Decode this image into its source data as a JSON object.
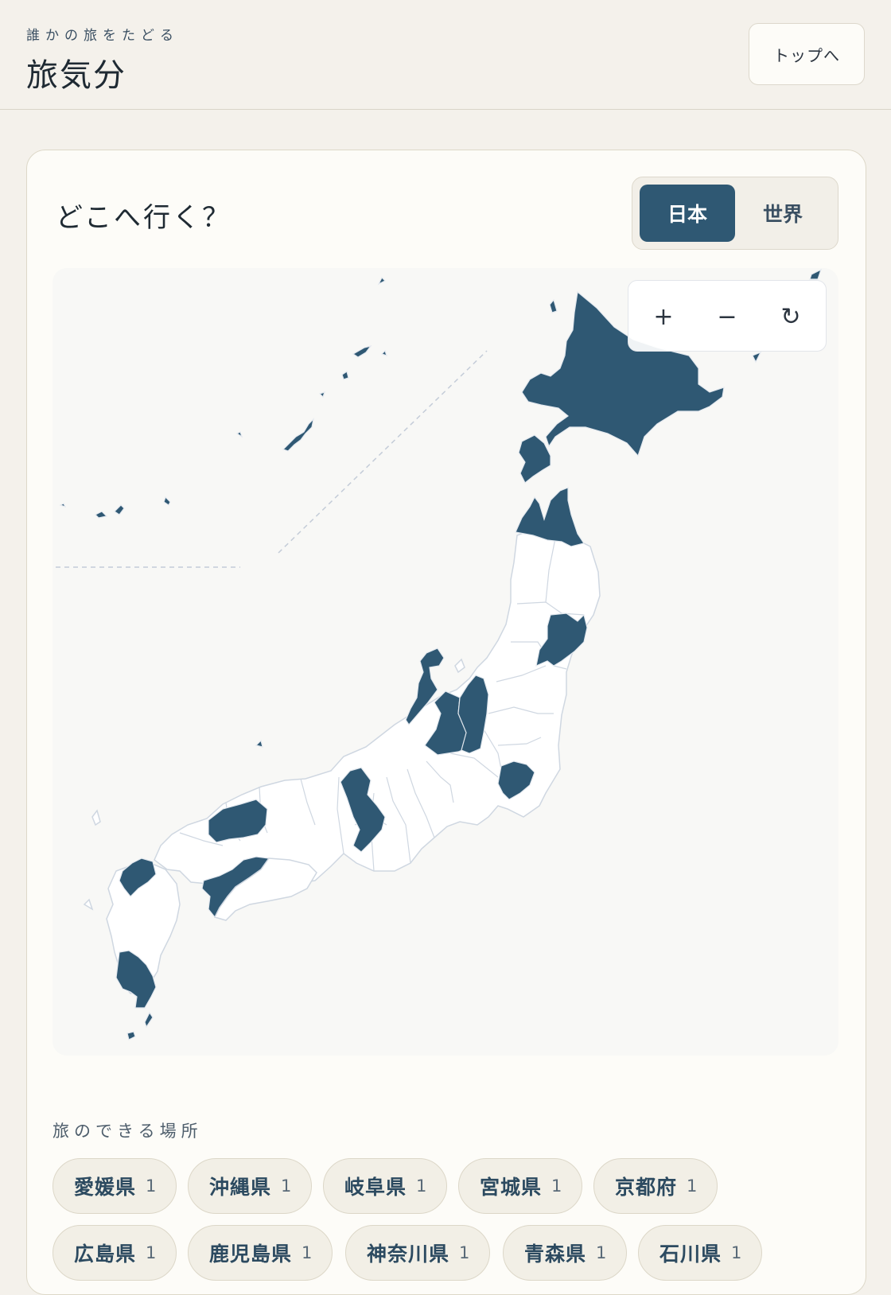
{
  "header": {
    "tagline": "誰かの旅をたどる",
    "title": "旅気分",
    "top_button": "トップへ"
  },
  "card": {
    "title": "どこへ行く？",
    "segment": {
      "active": "日本",
      "inactive": "世界"
    }
  },
  "map": {
    "zoom_in": "+",
    "zoom_out": "−",
    "reset": "↻",
    "zoom_in_icon": "plus-icon",
    "zoom_out_icon": "minus-icon",
    "reset_icon": "reset-icon",
    "visited_color": "#2f5873"
  },
  "places": {
    "label": "旅のできる場所",
    "items": [
      {
        "name": "愛媛県",
        "count": "1"
      },
      {
        "name": "沖縄県",
        "count": "1"
      },
      {
        "name": "岐阜県",
        "count": "1"
      },
      {
        "name": "宮城県",
        "count": "1"
      },
      {
        "name": "京都府",
        "count": "1"
      },
      {
        "name": "広島県",
        "count": "1"
      },
      {
        "name": "鹿児島県",
        "count": "1"
      },
      {
        "name": "神奈川県",
        "count": "1"
      },
      {
        "name": "青森県",
        "count": "1"
      },
      {
        "name": "石川県",
        "count": "1"
      }
    ]
  }
}
